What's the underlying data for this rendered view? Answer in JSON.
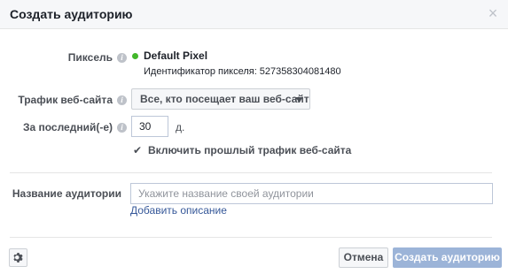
{
  "dialog": {
    "title": "Создать аудиторию",
    "close_glyph": "×"
  },
  "pixel": {
    "label": "Пиксель",
    "name": "Default Pixel",
    "id_text": "Идентификатор пикселя: 527358304081480",
    "status_color": "#42b72a"
  },
  "traffic": {
    "label": "Трафик веб-сайта",
    "selected": "Все, кто посещает ваш веб-сайт"
  },
  "period": {
    "label": "За последний(-е)",
    "value": "30",
    "unit": "д."
  },
  "past_traffic": {
    "checked": true,
    "check_glyph": "✔",
    "label": "Включить прошлый трафик веб-сайта"
  },
  "audience_name": {
    "label": "Название аудитории",
    "placeholder": "Укажите название своей аудитории",
    "value": ""
  },
  "add_description_link": "Добавить описание",
  "footer": {
    "cancel_label": "Отмена",
    "create_label": "Создать аудиторию",
    "create_color": "#9cb4d8"
  },
  "info_glyph": "i",
  "icons": [
    "info-icon",
    "status-dot-icon",
    "caret-down-icon",
    "check-icon",
    "gear-icon",
    "close-icon"
  ]
}
